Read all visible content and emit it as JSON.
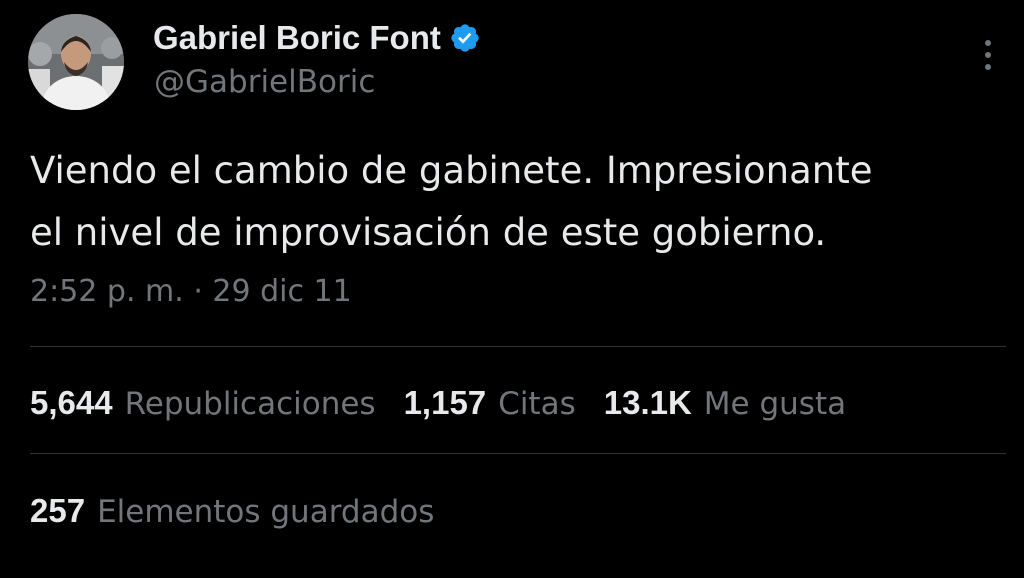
{
  "colors": {
    "background": "#000000",
    "primary_text": "#e7e9ea",
    "secondary_text": "#71767b",
    "divider": "#2f3336",
    "verified_badge": "#1d9bf0"
  },
  "author": {
    "display_name": "Gabriel Boric Font",
    "handle": "@GabrielBoric",
    "verified_icon": "verified-badge-icon",
    "avatar": "profile-photo"
  },
  "tweet": {
    "lines": [
      "Viendo el cambio de gabinete. Impresionante",
      "el nivel de improvisación de este gobierno."
    ],
    "time": "2:52 p. m.",
    "separator": "·",
    "date": "29 dic 11"
  },
  "stats": {
    "retweets": {
      "value": "5,644",
      "label": "Republicaciones"
    },
    "quotes": {
      "value": "1,157",
      "label": "Citas"
    },
    "likes": {
      "value": "13.1K",
      "label": "Me gusta"
    },
    "bookmarks": {
      "value": "257",
      "label": "Elementos guardados"
    }
  },
  "menu": {
    "more_icon": "more-vertical-icon"
  }
}
